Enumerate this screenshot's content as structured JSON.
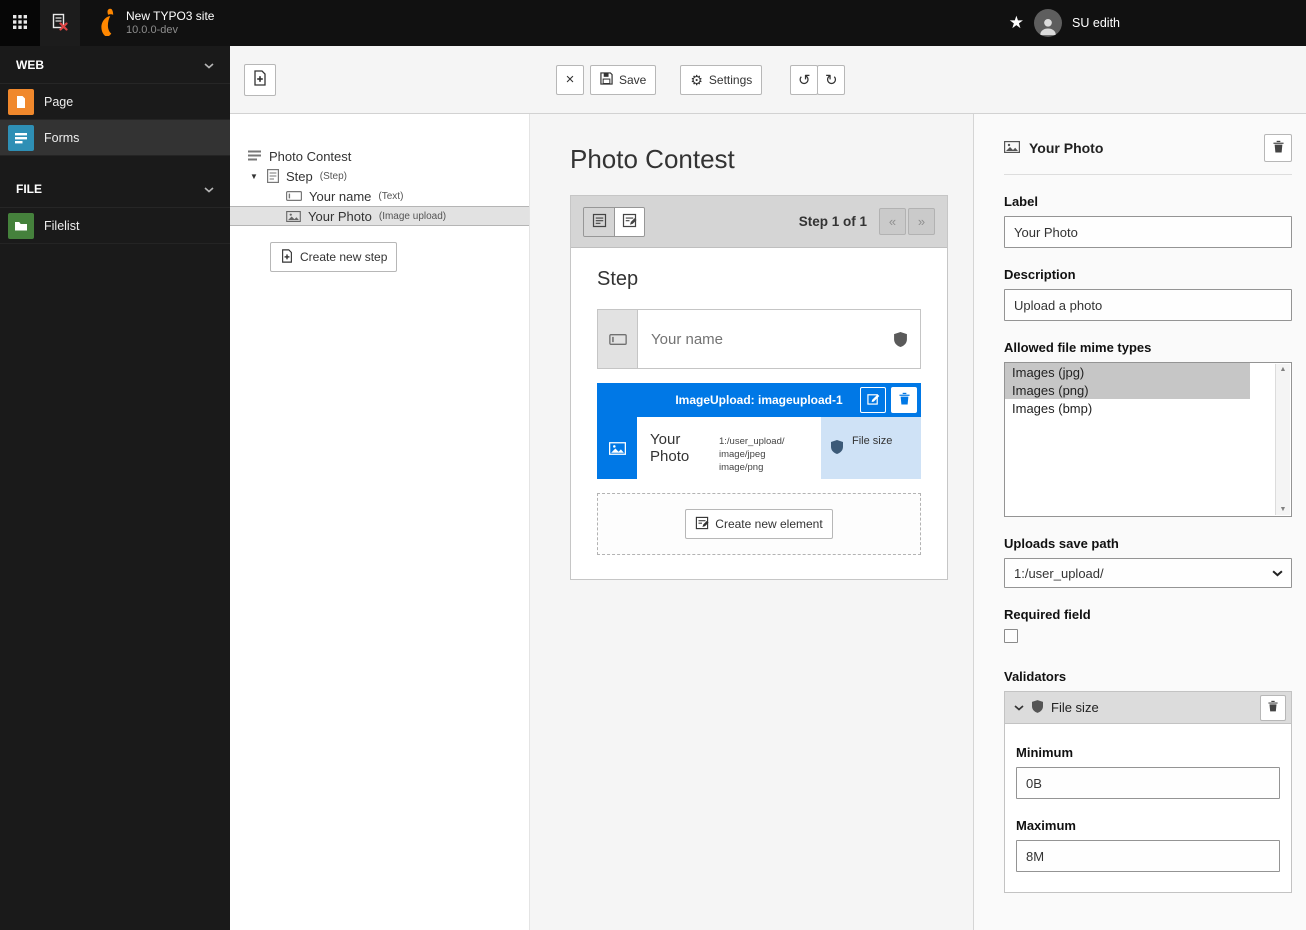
{
  "topbar": {
    "site_title": "New TYPO3 site",
    "site_version": "10.0.0-dev",
    "username": "SU edith"
  },
  "sidebar": {
    "web_section": "WEB",
    "file_section": "FILE",
    "page": "Page",
    "forms": "Forms",
    "filelist": "Filelist"
  },
  "toolbar": {
    "close": "×",
    "save": "Save",
    "settings": "Settings",
    "undo": "↺",
    "redo": "↻"
  },
  "tree": {
    "items": [
      {
        "label": "Photo Contest",
        "suffix": ""
      },
      {
        "label": "Step",
        "suffix": "(Step)"
      },
      {
        "label": "Your name",
        "suffix": "(Text)"
      },
      {
        "label": "Your Photo",
        "suffix": "(Image upload)"
      }
    ],
    "create_step": "Create new step"
  },
  "stage": {
    "title": "Photo Contest",
    "paginator": {
      "label": "Step 1 of 1",
      "prev": "«",
      "next": "»"
    },
    "step_heading": "Step",
    "text_element": {
      "placeholder": "Your name"
    },
    "selected_element": {
      "header": "ImageUpload: imageupload-1",
      "label": "Your Photo",
      "details": [
        "1:/user_upload/",
        "image/jpeg",
        "image/png"
      ],
      "validator_badge": "File size"
    },
    "create_element": "Create new element"
  },
  "inspector": {
    "title": "Your Photo",
    "label_field": {
      "label": "Label",
      "value": "Your Photo"
    },
    "description_field": {
      "label": "Description",
      "value": "Upload a photo"
    },
    "mime_field": {
      "label": "Allowed file mime types",
      "options": [
        {
          "label": "Images (jpg)",
          "selected": true
        },
        {
          "label": "Images (png)",
          "selected": true
        },
        {
          "label": "Images (bmp)",
          "selected": false
        }
      ]
    },
    "save_path_field": {
      "label": "Uploads save path",
      "value": "1:/user_upload/"
    },
    "required_field": {
      "label": "Required field"
    },
    "validators": {
      "label": "Validators",
      "validator_name": "File size",
      "minimum": {
        "label": "Minimum",
        "value": "0B"
      },
      "maximum": {
        "label": "Maximum",
        "value": "8M"
      }
    }
  },
  "colors": {
    "accent_blue": "#0078e6",
    "typo3_orange": "#ff8700"
  }
}
